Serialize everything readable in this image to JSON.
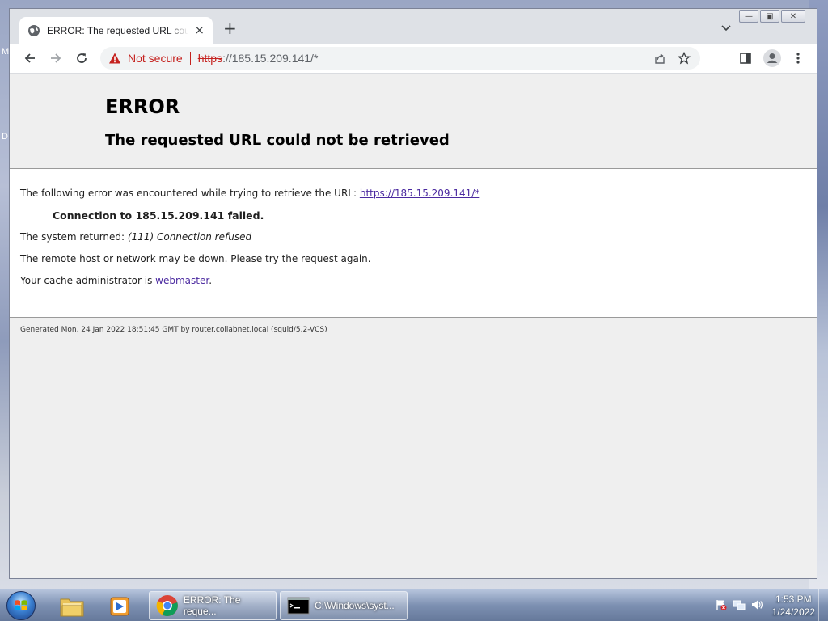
{
  "desktop": {
    "letters": [
      "M",
      "D"
    ]
  },
  "window": {
    "controls": {
      "minimize": "—",
      "maximize": "▣",
      "close": "✕"
    }
  },
  "tab": {
    "title": "ERROR: The requested URL could not be retrieved",
    "close": "×",
    "new_tab": "+"
  },
  "omnibox": {
    "security_label": "Not secure",
    "url_scheme": "https",
    "url_rest": "://185.15.209.141/*"
  },
  "page": {
    "title": "ERROR",
    "subtitle": "The requested URL could not be retrieved",
    "intro": "The following error was encountered while trying to retrieve the URL: ",
    "intro_link": "https://185.15.209.141/*",
    "failure": "Connection to 185.15.209.141 failed.",
    "system_prefix": "The system returned: ",
    "system_error": "(111) Connection refused",
    "remote_host": "The remote host or network may be down. Please try the request again.",
    "admin_prefix": "Your cache administrator is ",
    "admin_link": "webmaster",
    "admin_suffix": ".",
    "footer": "Generated Mon, 24 Jan 2022 18:51:45 GMT by router.collabnet.local (squid/5.2-VCS)"
  },
  "taskbar": {
    "tasks": [
      {
        "label": "ERROR: The reque..."
      },
      {
        "label": "C:\\Windows\\syst..."
      }
    ],
    "time": "1:53 PM",
    "date": "1/24/2022"
  }
}
